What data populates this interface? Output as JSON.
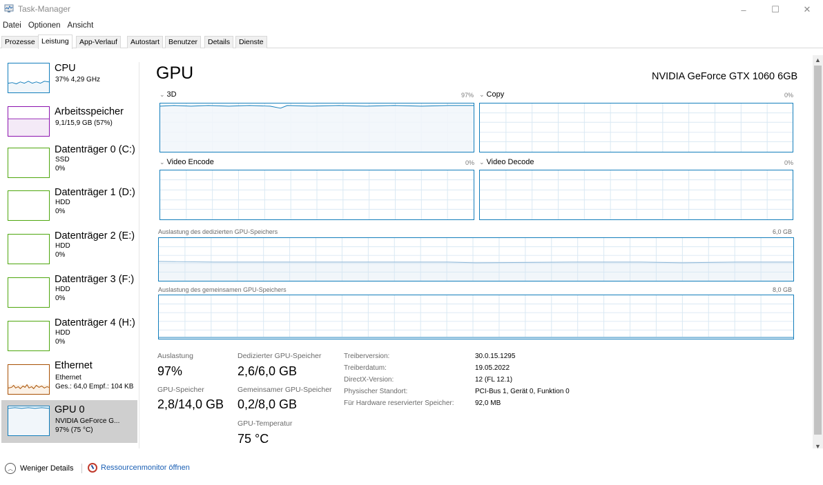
{
  "window": {
    "title": "Task-Manager",
    "controls": {
      "minimize": "–",
      "maximize": "☐",
      "close": "✕"
    }
  },
  "menu": [
    "Datei",
    "Optionen",
    "Ansicht"
  ],
  "tabs": [
    "Prozesse",
    "Leistung",
    "App-Verlauf",
    "Autostart",
    "Benutzer",
    "Details",
    "Dienste"
  ],
  "active_tab": "Leistung",
  "sidebar": {
    "items": [
      {
        "name": "CPU",
        "line1": "37% 4,29 GHz",
        "line2": ""
      },
      {
        "name": "Arbeitsspeicher",
        "line1": "9,1/15,9 GB (57%)",
        "line2": ""
      },
      {
        "name": "Datenträger 0 (C:)",
        "line1": "SSD",
        "line2": "0%"
      },
      {
        "name": "Datenträger 1 (D:)",
        "line1": "HDD",
        "line2": "0%"
      },
      {
        "name": "Datenträger 2 (E:)",
        "line1": "HDD",
        "line2": "0%"
      },
      {
        "name": "Datenträger 3 (F:)",
        "line1": "HDD",
        "line2": "0%"
      },
      {
        "name": "Datenträger 4 (H:)",
        "line1": "HDD",
        "line2": "0%"
      },
      {
        "name": "Ethernet",
        "line1": "Ethernet",
        "line2": "Ges.: 64,0 Empf.: 104 KB"
      },
      {
        "name": "GPU 0",
        "line1": "NVIDIA GeForce G...",
        "line2": "97% (75 °C)"
      }
    ],
    "selected": "GPU 0"
  },
  "main": {
    "title": "GPU",
    "model": "NVIDIA GeForce GTX 1060 6GB",
    "engines": [
      {
        "label": "3D",
        "percent": "97%",
        "level": 0.97
      },
      {
        "label": "Copy",
        "percent": "0%",
        "level": 0.0
      },
      {
        "label": "Video Encode",
        "percent": "0%",
        "level": 0.0
      },
      {
        "label": "Video Decode",
        "percent": "0%",
        "level": 0.0
      }
    ],
    "dedicated_memory": {
      "label": "Auslastung des dedizierten GPU-Speichers",
      "max": "6,0 GB",
      "level": 0.43
    },
    "shared_memory": {
      "label": "Auslastung des gemeinsamen GPU-Speichers",
      "max": "8,0 GB",
      "level": 0.03
    },
    "stats": {
      "utilization_label": "Auslastung",
      "utilization": "97%",
      "dedicated_label": "Dedizierter GPU-Speicher",
      "dedicated": "2,6/6,0 GB",
      "gpu_memory_label": "GPU-Speicher",
      "gpu_memory": "2,8/14,0 GB",
      "shared_label": "Gemeinsamer GPU-Speicher",
      "shared": "0,2/8,0 GB",
      "temp_label": "GPU-Temperatur",
      "temp": "75 °C"
    },
    "info": [
      {
        "key": "Treiberversion:",
        "value": "30.0.15.1295"
      },
      {
        "key": "Treiberdatum:",
        "value": "19.05.2022"
      },
      {
        "key": "DirectX-Version:",
        "value": "12 (FL 12.1)"
      },
      {
        "key": "Physischer Standort:",
        "value": "PCI-Bus 1, Gerät 0, Funktion 0"
      },
      {
        "key": "Für Hardware reservierter Speicher:",
        "value": "92,0 MB"
      }
    ]
  },
  "footer": {
    "less_details": "Weniger Details",
    "resource_monitor": "Ressourcenmonitor öffnen"
  },
  "colors": {
    "graph_border": "#117dbb",
    "graph_fill": "#f1f6fa",
    "memory_border": "#8b12ae",
    "ethernet_border": "#a74f01",
    "selected_bg": "#cfcfcf",
    "link": "#1a5fb4"
  }
}
